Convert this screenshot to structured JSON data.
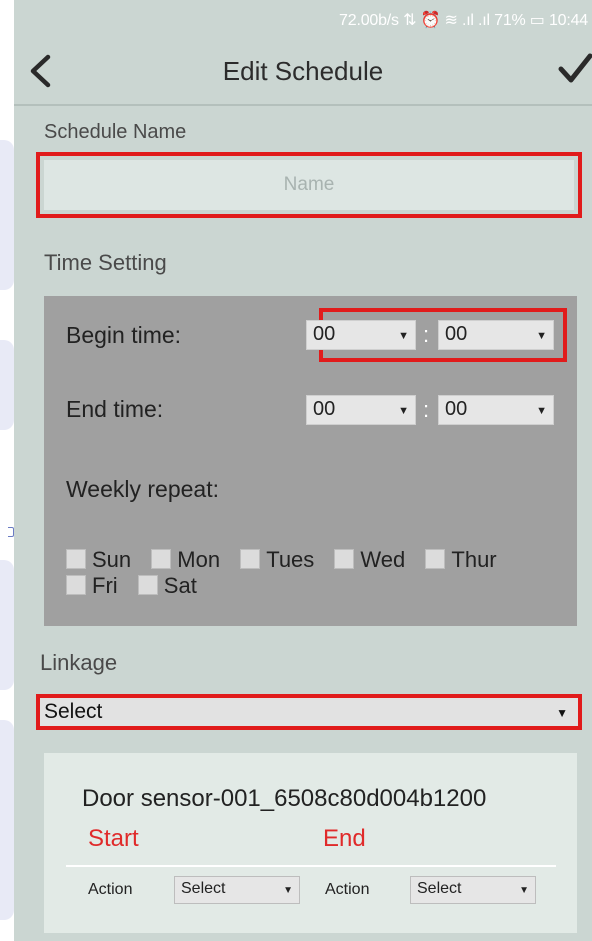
{
  "status_bar": {
    "text": "72.00b/s ⇅ ⏰ ≋ .ıl .ıl 71% ▭ 10:44"
  },
  "header": {
    "title": "Edit Schedule",
    "back_icon": "chevron-left-icon",
    "save_icon": "checkmark-icon"
  },
  "schedule_name": {
    "label": "Schedule Name",
    "placeholder": "Name",
    "value": ""
  },
  "time_setting": {
    "label": "Time Setting",
    "begin": {
      "label": "Begin time:",
      "hour": "00",
      "minute": "00"
    },
    "end": {
      "label": "End time:",
      "hour": "00",
      "minute": "00"
    },
    "colon": ":",
    "weekly_repeat_label": "Weekly repeat:",
    "days": [
      "Sun",
      "Mon",
      "Tues",
      "Wed",
      "Thur",
      "Fri",
      "Sat"
    ],
    "days_checked": [
      false,
      false,
      false,
      false,
      false,
      false,
      false
    ]
  },
  "linkage": {
    "label": "Linkage",
    "selected": "Select"
  },
  "device": {
    "name": "Door sensor-001_6508c80d004b1200",
    "start_label": "Start",
    "end_label": "End",
    "start_action_label": "Action",
    "start_action_value": "Select",
    "end_action_label": "Action",
    "end_action_value": "Select"
  },
  "colors": {
    "background": "#cbd6d2",
    "highlight": "#e11b1b",
    "panel": "#a0a0a0",
    "accent_red_text": "#e02a2a"
  }
}
